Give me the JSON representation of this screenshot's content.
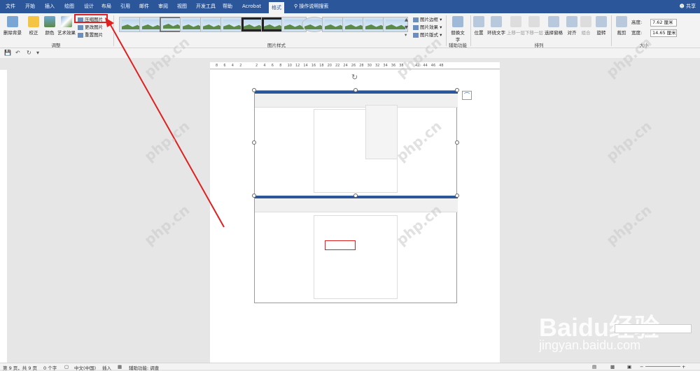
{
  "menu": {
    "tabs": [
      "文件",
      "开始",
      "插入",
      "绘图",
      "设计",
      "布局",
      "引用",
      "邮件",
      "审阅",
      "视图",
      "开发工具",
      "帮助",
      "Acrobat",
      "格式"
    ],
    "active_tab": "格式",
    "search": "操作说明搜索",
    "share": "共享"
  },
  "ribbon": {
    "adjust": {
      "remove_bg": "删除背景",
      "correct": "校正",
      "color": "颜色",
      "art_effect": "艺术效果",
      "compress": "压缩图片",
      "change": "更改图片",
      "reset": "重置图片",
      "label": "调整"
    },
    "styles": {
      "border": "图片边框",
      "effect": "图片效果",
      "layout": "图片版式",
      "label": "图片样式"
    },
    "accessibility": {
      "alt_text": "替换文字",
      "label": "辅助功能"
    },
    "arrange": {
      "position": "位置",
      "wrap": "环绕文字",
      "forward": "上移一层",
      "backward": "下移一层",
      "select_pane": "选择窗格",
      "align": "对齐",
      "group": "组合",
      "rotate": "旋转",
      "label": "排列"
    },
    "size": {
      "crop": "裁剪",
      "height_label": "高度:",
      "height_value": "7.62 厘米",
      "width_label": "宽度:",
      "width_value": "14.65 厘米",
      "label": "大小"
    }
  },
  "ruler": {
    "ticks": [
      "8",
      "6",
      "4",
      "2",
      "",
      "2",
      "4",
      "6",
      "8",
      "10",
      "12",
      "14",
      "16",
      "18",
      "20",
      "22",
      "24",
      "26",
      "28",
      "30",
      "32",
      "34",
      "36",
      "38",
      "",
      "42",
      "44",
      "46",
      "48"
    ]
  },
  "status": {
    "page": "第 9 页，共 9 页",
    "words": "0 个字",
    "lang": "中文(中国)",
    "mode": "插入",
    "accessibility": "辅助功能: 调查"
  },
  "watermark": {
    "text": "php.cn",
    "brand": "Baidu经验",
    "url": "jingyan.baidu.com"
  },
  "colors": {
    "accent": "#2b579a",
    "highlight": "#e02020"
  }
}
